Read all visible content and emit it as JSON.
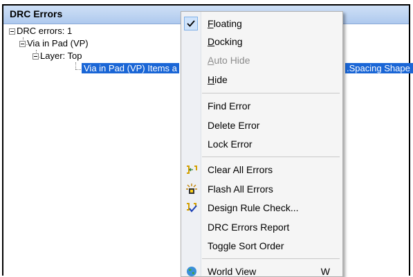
{
  "panel": {
    "title": "DRC Errors"
  },
  "tree": {
    "root": "DRC errors: 1",
    "rule": "Via in Pad (VP)",
    "layer": "Layer: Top",
    "item_left": "Via in Pad (VP) Items a",
    "item_right": ".Spacing Shape"
  },
  "menu": {
    "floating": {
      "first": "F",
      "rest": "loating",
      "checked": true
    },
    "docking": {
      "first": "D",
      "rest": "ocking"
    },
    "auto_hide": {
      "first": "A",
      "rest": "uto Hide",
      "disabled": true
    },
    "hide": {
      "first": "H",
      "rest": "ide"
    },
    "find_error": "Find Error",
    "delete_error": "Delete Error",
    "lock_error": "Lock Error",
    "clear_all_errors": "Clear All Errors",
    "flash_all_errors": "Flash All Errors",
    "design_rule_check": "Design Rule Check...",
    "drc_errors_report": "DRC Errors Report",
    "toggle_sort_order": "Toggle Sort Order",
    "world_view": "World View",
    "world_view_shortcut": "W"
  },
  "colors": {
    "header": "#aec9ee",
    "selection": "#1a66d6",
    "menu_bg": "#f5f5f5"
  }
}
